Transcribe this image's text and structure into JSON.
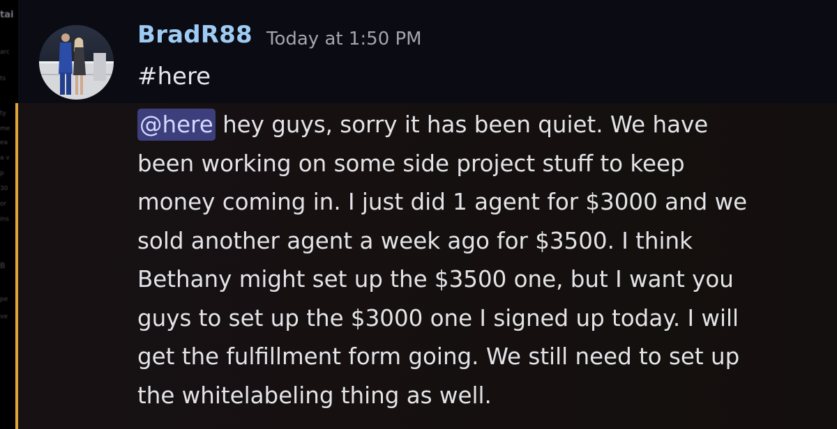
{
  "message": {
    "username": "BradR88",
    "timestamp": "Today at 1:50 PM",
    "first_line": "#here",
    "mention": "@here",
    "body_lines": [
      " hey guys, sorry it has been quiet. We have",
      "been working on some side project stuff to keep",
      "money coming in. I just did 1 agent for $3000 and we",
      "sold another agent a week ago for $3500. I think",
      "Bethany might set up the $3500 one, but I want you",
      "guys to set up the $3000 one I signed up today. I will",
      "get the fulfillment form going. We still need to set up",
      "the whitelabeling thing as well."
    ]
  },
  "colors": {
    "username": "#9ecbf3",
    "mention_bar": "#e0a43a",
    "mention_pill_bg": "#3d3f7c",
    "header_bg": "#0b0b14",
    "highlight_bg": "#16100f"
  }
}
